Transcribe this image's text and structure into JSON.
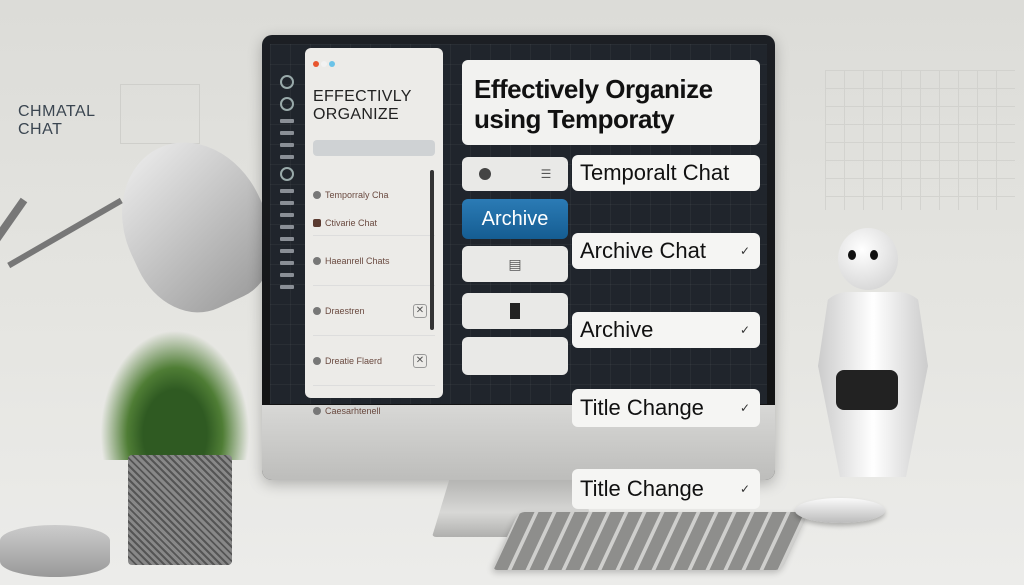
{
  "wall_text": {
    "line1": "CHMATAL",
    "line2": "CHAT"
  },
  "sidebar": {
    "title": "EFFECTIVLY ORGANIZE",
    "window_dots": [
      "#e8552f",
      "#f2f2f2",
      "#6bc3e8"
    ],
    "items": [
      {
        "label": "Temporraly Cha"
      },
      {
        "label": "Ctivarie Chat"
      },
      {
        "label": "Haeanrell Chats"
      },
      {
        "label": "Draestren"
      },
      {
        "label": "Dreatie Flaerd"
      },
      {
        "label": "Caesarhtenell"
      }
    ]
  },
  "main": {
    "title": "Effectively Organize using Temporaty",
    "rows": [
      {
        "left": "",
        "label": "Temporalt Chat",
        "check": ""
      },
      {
        "left": "Archive",
        "label": "Archive Chat",
        "check": "✓"
      },
      {
        "left": "",
        "label": "Archive",
        "check": "✓"
      },
      {
        "left": "",
        "label": "Title Change",
        "check": "✓"
      },
      {
        "left": "",
        "label": "Title Change",
        "check": "✓"
      }
    ]
  },
  "colors": {
    "accent": "#1f6fa8",
    "screen_bg": "#20252c"
  }
}
